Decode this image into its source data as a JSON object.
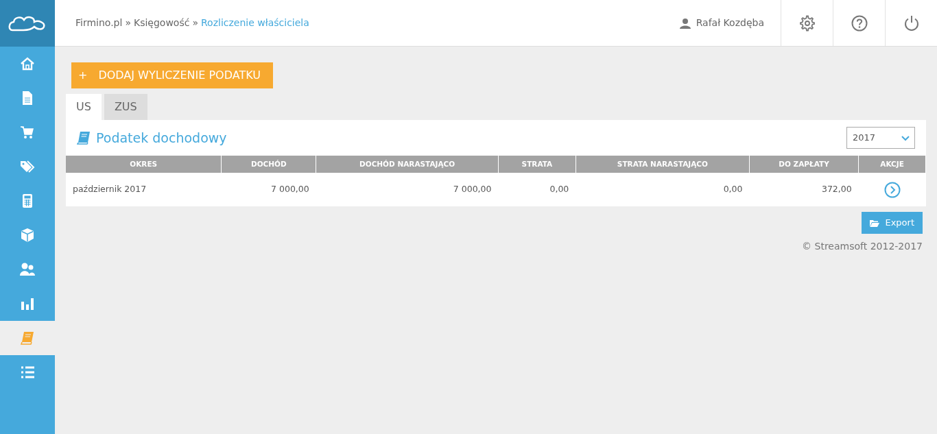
{
  "sidebar": {
    "items": [
      {
        "kind": "home",
        "selected": false
      },
      {
        "kind": "document",
        "selected": false
      },
      {
        "kind": "cart",
        "selected": false
      },
      {
        "kind": "tags",
        "selected": false
      },
      {
        "kind": "calculator",
        "selected": false
      },
      {
        "kind": "cube",
        "selected": false
      },
      {
        "kind": "users",
        "selected": false
      },
      {
        "kind": "chart",
        "selected": false
      },
      {
        "kind": "book",
        "selected": true
      },
      {
        "kind": "list",
        "selected": false
      }
    ]
  },
  "breadcrumb": [
    {
      "kind": "link",
      "text": "Firmino.pl"
    },
    {
      "kind": "separator",
      "text": "»"
    },
    {
      "kind": "link",
      "text": "Księgowość"
    },
    {
      "kind": "separator",
      "text": "»"
    },
    {
      "kind": "current",
      "text": "Rozliczenie właściciela"
    }
  ],
  "user": {
    "name": "Rafał Kozdęba"
  },
  "add_button": {
    "icon": "+",
    "label": "DODAJ WYLICZENIE PODATKU"
  },
  "tabs": [
    {
      "label": "US",
      "selected": true
    },
    {
      "label": "ZUS",
      "selected": false
    }
  ],
  "panel": {
    "title": "Podatek dochodowy",
    "year_select": {
      "value": "2017"
    }
  },
  "table": {
    "columns": [
      "OKRES",
      "DOCHÓD",
      "DOCHÓD NARASTAJĄCO",
      "STRATA",
      "STRATA NARASTAJĄCO",
      "DO ZAPŁATY",
      "AKCJE"
    ],
    "rows": [
      [
        "październik 2017",
        "7 000,00",
        "7 000,00",
        "0,00",
        "0,00",
        "372,00"
      ]
    ]
  },
  "export_button": {
    "label": "Export"
  },
  "footer": {
    "text": "© Streamsoft 2012-2017"
  }
}
